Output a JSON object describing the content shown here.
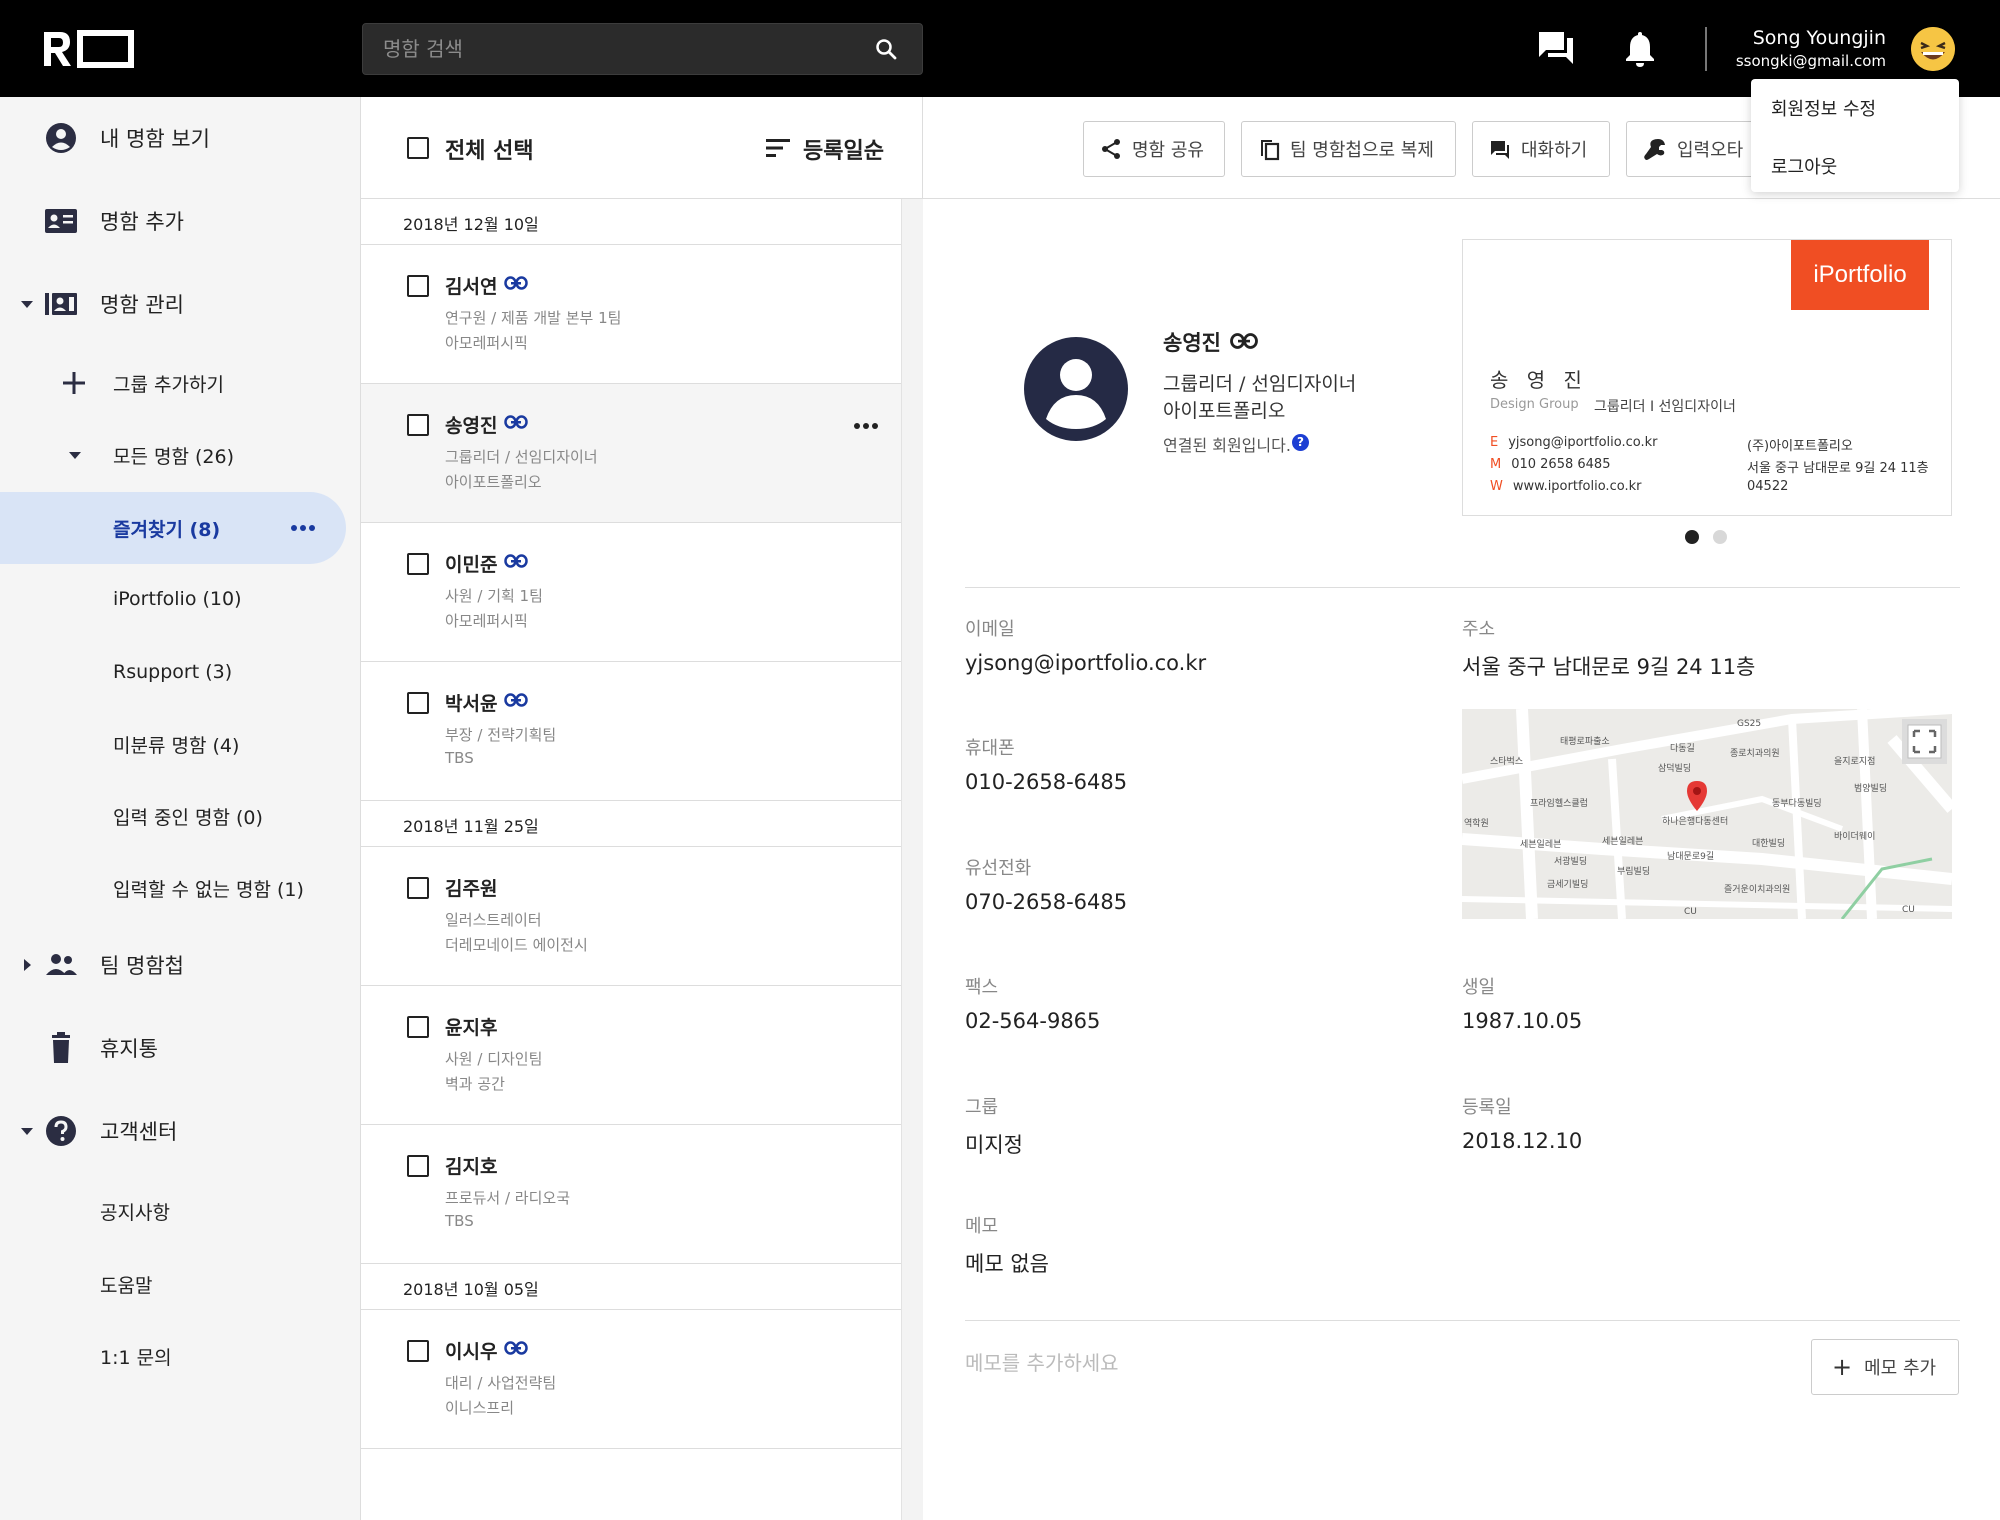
{
  "header": {
    "search_placeholder": "명함 검색",
    "user_name": "Song Youngjin",
    "user_email": "ssongki@gmail.com"
  },
  "user_menu": {
    "items": [
      "회원정보 수정",
      "로그아웃"
    ]
  },
  "sidebar": {
    "my_card": "내 명함 보기",
    "add_card": "명함 추가",
    "manage": "명함 관리",
    "add_group": "그룹 추가하기",
    "all_cards": "모든 명함 (26)",
    "favorites": "즐겨찾기 (8)",
    "groups": [
      "iPortfolio (10)",
      "Rsupport (3)",
      "미분류 명함 (4)",
      "입력 중인 명함 (0)",
      "입력할 수 없는 명함 (1)"
    ],
    "team": "팀 명함첩",
    "trash": "휴지통",
    "support": "고객센터",
    "support_items": [
      "공지사항",
      "도움말",
      "1:1 문의"
    ]
  },
  "list": {
    "select_all": "전체 선택",
    "sort": "등록일순",
    "dates": [
      "2018년 12월 10일",
      "2018년 11월 25일",
      "2018년 10월 05일"
    ],
    "cards": [
      {
        "name": "김서연",
        "role": "연구원 / 제품 개발 본부  1팀",
        "company": "아모레퍼시픽",
        "linked": true
      },
      {
        "name": "송영진",
        "role": "그룹리더 / 선임디자이너",
        "company": "아이포트폴리오",
        "linked": true
      },
      {
        "name": "이민준",
        "role": "사원 / 기획 1팀",
        "company": "아모레퍼시픽",
        "linked": true
      },
      {
        "name": "박서윤",
        "role": "부장 / 전략기획팀",
        "company": "TBS",
        "linked": true
      },
      {
        "name": "김주원",
        "role": "일러스트레이터",
        "company": "더레모네이드 에이전시",
        "linked": false
      },
      {
        "name": "윤지후",
        "role": "사원 / 디자인팀",
        "company": "벽과 공간",
        "linked": false
      },
      {
        "name": "김지호",
        "role": "프로듀서 / 라디오국",
        "company": "TBS",
        "linked": false
      },
      {
        "name": "이시우",
        "role": "대리 / 사업전략팀",
        "company": "이니스프리",
        "linked": true
      }
    ]
  },
  "toolbar": {
    "share": "명함 공유",
    "copy_team": "팀 명함첩으로 복제",
    "chat": "대화하기",
    "report": "입력오타"
  },
  "profile": {
    "name": "송영진",
    "role": "그룹리더 / 선임디자이너",
    "company": "아이포트폴리오",
    "linked_text": "연결된 회원입니다."
  },
  "business_card": {
    "logo": "iPortfolio",
    "name": "송 영 진",
    "group": "Design Group",
    "role": "그룹리더 I 선임디자이너",
    "email_key": "E",
    "email": "yjsong@iportfolio.co.kr",
    "mobile_key": "M",
    "mobile": "010 2658 6485",
    "web_key": "W",
    "web": "www.iportfolio.co.kr",
    "company": "(주)아이포트폴리오",
    "address": "서울 중구 남대문로 9길 24 11층",
    "zip": "04522"
  },
  "fields": {
    "email_label": "이메일",
    "email": "yjsong@iportfolio.co.kr",
    "address_label": "주소",
    "address": "서울 중구 남대문로 9길 24 11층",
    "mobile_label": "휴대폰",
    "mobile": "010-2658-6485",
    "phone_label": "유선전화",
    "phone": "070-2658-6485",
    "fax_label": "팩스",
    "fax": "02-564-9865",
    "birthday_label": "생일",
    "birthday": "1987.10.05",
    "group_label": "그룹",
    "group": "미지정",
    "regdate_label": "등록일",
    "regdate": "2018.12.10",
    "memo_label": "메모",
    "memo": "메모 없음"
  },
  "map_labels": [
    "태평로파출소",
    "다동길",
    "GS25",
    "스타벅스",
    "삼덕빌딩",
    "종로치과의원",
    "을지로지점",
    "프라임헬스클럽",
    "범양빌딩",
    "동부다동빌딩",
    "하나은행다동센터",
    "역학원",
    "세븐일레븐",
    "세븐일레븐",
    "대한빌딩",
    "바이더웨이",
    "서광빌딩",
    "남대문로9길",
    "부림빌딩",
    "금세기빌딩",
    "즐거운이치과의원",
    "CU",
    "CU"
  ],
  "memo_area": {
    "placeholder": "메모를 추가하세요",
    "add_button": "메모 추가"
  },
  "colors": {
    "accent_blue": "#1a3aa0",
    "active_bg": "#d9e4f6",
    "brand_orange": "#f04e23",
    "map_pin": "#e53935"
  }
}
